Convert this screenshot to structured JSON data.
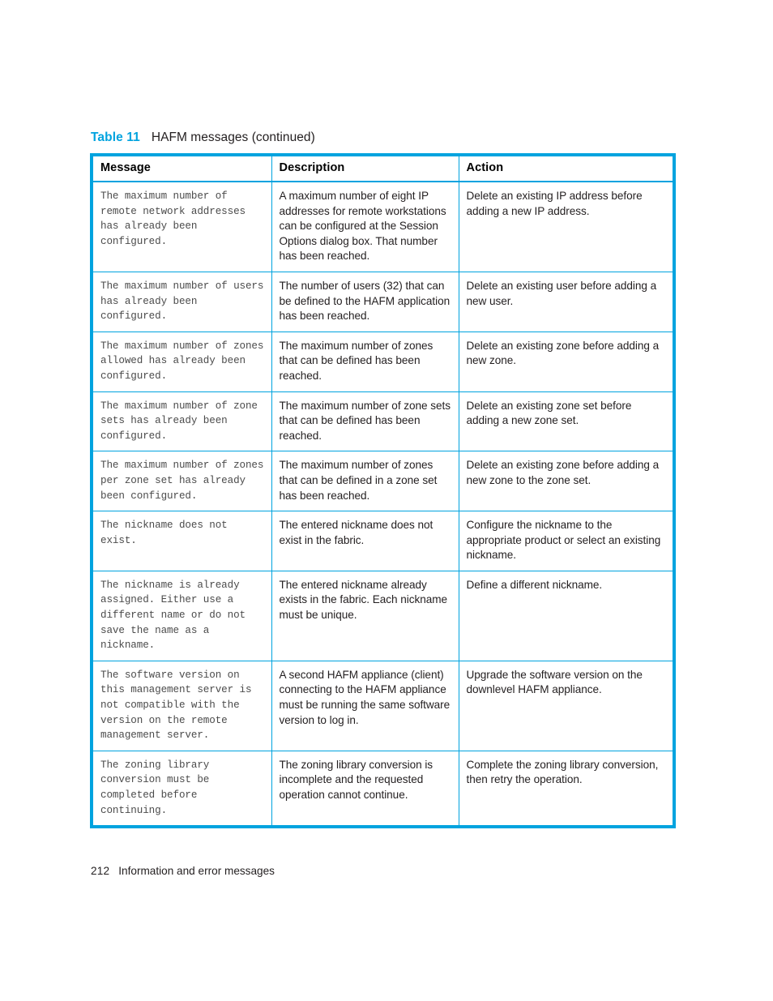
{
  "document": {
    "caption": {
      "label": "Table 11",
      "title": "HAFM messages (continued)"
    },
    "accent_color": "#00A3DF",
    "text_color": "#231f20"
  },
  "table": {
    "headers": {
      "message": "Message",
      "description": "Description",
      "action": "Action"
    },
    "rows": [
      {
        "message": "The maximum number of remote network addresses has already been configured.",
        "description": "A maximum number of eight IP addresses for remote workstations can be configured at the Session Options dialog box. That number has been reached.",
        "action": "Delete an existing IP address before adding a new IP address."
      },
      {
        "message": "The maximum number of users has already been configured.",
        "description": "The number of users (32) that can be defined to the HAFM application has been reached.",
        "action": "Delete an existing user before adding a new user."
      },
      {
        "message": "The maximum number of zones allowed has already been configured.",
        "description": "The maximum number of zones that can be defined has been reached.",
        "action": "Delete an existing zone before adding a new zone."
      },
      {
        "message": "The maximum number of zone sets has already been configured.",
        "description": "The maximum number of zone sets that can be defined has been reached.",
        "action": "Delete an existing zone set before adding a new zone set."
      },
      {
        "message": "The maximum number of zones per zone set has already been configured.",
        "description": "The maximum number of zones that can be defined in a zone set has been reached.",
        "action": "Delete an existing zone before adding a new zone to the zone set."
      },
      {
        "message": "The nickname does not exist.",
        "description": "The entered nickname does not exist in the fabric.",
        "action": "Configure the nickname to the appropriate product or select an existing nickname."
      },
      {
        "message": "The nickname is already assigned. Either use a different name or do not save the name as a nickname.",
        "description": "The entered nickname already exists in the fabric. Each nickname must be unique.",
        "action": "Define a different nickname."
      },
      {
        "message": "The software version on this management server is not compatible with the version on the remote management server.",
        "description": "A second HAFM appliance (client) connecting to the HAFM appliance must be running the same software version to log in.",
        "action": "Upgrade the software version on the downlevel HAFM appliance."
      },
      {
        "message": "The zoning library conversion must be completed before continuing.",
        "description": "The zoning library conversion is incomplete and the requested operation cannot continue.",
        "action": "Complete the zoning library conversion, then retry the operation."
      }
    ]
  },
  "footer": {
    "page_number": "212",
    "section_title": "Information and error messages"
  }
}
